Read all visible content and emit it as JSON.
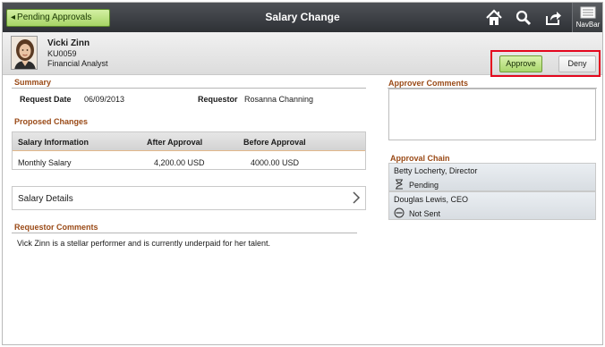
{
  "header_bar": {
    "back_label": "Pending Approvals",
    "title": "Salary Change",
    "navbar_label": "NavBar",
    "icons": [
      "home-icon",
      "search-icon",
      "share-icon",
      "navbar-icon"
    ]
  },
  "employee": {
    "name": "Vicki Zinn",
    "id": "KU0059",
    "title": "Financial Analyst"
  },
  "actions": {
    "approve_label": "Approve",
    "deny_label": "Deny"
  },
  "summary": {
    "heading": "Summary",
    "request_date_label": "Request Date",
    "request_date": "06/09/2013",
    "requestor_label": "Requestor",
    "requestor": "Rosanna Channing"
  },
  "proposed_changes": {
    "heading": "Proposed Changes",
    "columns": [
      "Salary Information",
      "After Approval",
      "Before Approval"
    ],
    "rows": [
      [
        "Monthly Salary",
        "4,200.00 USD",
        "4000.00 USD"
      ]
    ]
  },
  "salary_details": {
    "label": "Salary Details"
  },
  "requestor_comments": {
    "heading": "Requestor Comments",
    "text": "Vick Zinn is a stellar performer and is currently underpaid for her talent."
  },
  "approver_comments": {
    "heading": "Approver Comments",
    "value": ""
  },
  "approval_chain": {
    "heading": "Approval Chain",
    "items": [
      {
        "name": "Betty Locherty, Director",
        "status": "Pending",
        "icon": "hourglass-icon"
      },
      {
        "name": "Douglas Lewis, CEO",
        "status": "Not Sent",
        "icon": "not-sent-icon"
      }
    ]
  },
  "colors": {
    "banner": "#3e4146",
    "section_heading": "#9a4a17",
    "approve_green": "#a9d66c",
    "highlight_red": "#e4061d"
  }
}
